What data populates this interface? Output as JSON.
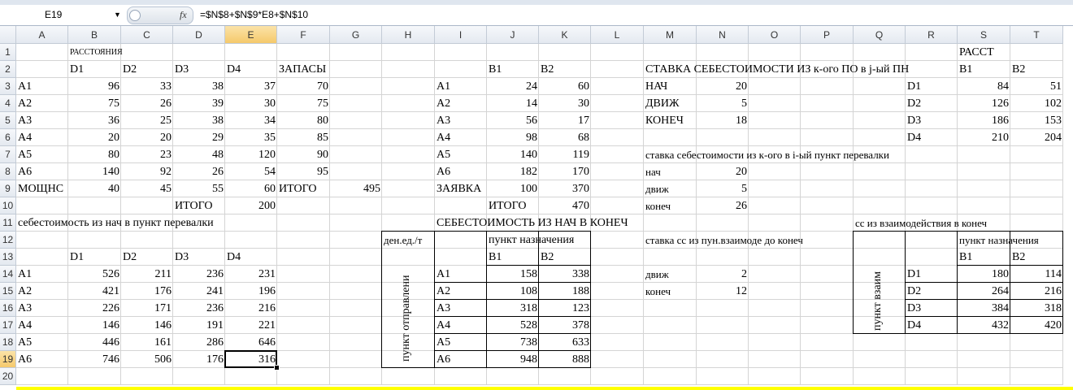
{
  "formula_bar": {
    "name_box": "E19",
    "fx_symbol": "fx",
    "formula": "=$N$8+$N$9*E8+$N$10"
  },
  "columns": [
    "A",
    "B",
    "C",
    "D",
    "E",
    "F",
    "G",
    "H",
    "I",
    "J",
    "K",
    "L",
    "M",
    "N",
    "O",
    "P",
    "Q",
    "R",
    "S",
    "T"
  ],
  "rows": [
    "1",
    "2",
    "3",
    "4",
    "5",
    "6",
    "7",
    "8",
    "9",
    "10",
    "11",
    "12",
    "13",
    "14",
    "15",
    "16",
    "17",
    "18",
    "19",
    "20"
  ],
  "selected": {
    "col": "E",
    "row": 19
  },
  "cells": [
    [
      "B1",
      "РАССТОЯНИЯ",
      "l",
      10
    ],
    [
      "B2",
      "D1"
    ],
    [
      "C2",
      "D2"
    ],
    [
      "D2",
      "D3"
    ],
    [
      "E2",
      "D4"
    ],
    [
      "F2",
      "ЗАПАСЫ"
    ],
    [
      "A3",
      "A1"
    ],
    [
      "B3",
      "96",
      "r"
    ],
    [
      "C3",
      "33",
      "r"
    ],
    [
      "D3",
      "38",
      "r"
    ],
    [
      "E3",
      "37",
      "r"
    ],
    [
      "F3",
      "70",
      "r"
    ],
    [
      "A4",
      "A2"
    ],
    [
      "B4",
      "75",
      "r"
    ],
    [
      "C4",
      "26",
      "r"
    ],
    [
      "D4",
      "39",
      "r"
    ],
    [
      "E4",
      "30",
      "r"
    ],
    [
      "F4",
      "75",
      "r"
    ],
    [
      "A5",
      "A3"
    ],
    [
      "B5",
      "36",
      "r"
    ],
    [
      "C5",
      "25",
      "r"
    ],
    [
      "D5",
      "38",
      "r"
    ],
    [
      "E5",
      "34",
      "r"
    ],
    [
      "F5",
      "80",
      "r"
    ],
    [
      "A6",
      "A4"
    ],
    [
      "B6",
      "20",
      "r"
    ],
    [
      "C6",
      "20",
      "r"
    ],
    [
      "D6",
      "29",
      "r"
    ],
    [
      "E6",
      "35",
      "r"
    ],
    [
      "F6",
      "85",
      "r"
    ],
    [
      "A7",
      "A5"
    ],
    [
      "B7",
      "80",
      "r"
    ],
    [
      "C7",
      "23",
      "r"
    ],
    [
      "D7",
      "48",
      "r"
    ],
    [
      "E7",
      "120",
      "r"
    ],
    [
      "F7",
      "90",
      "r"
    ],
    [
      "A8",
      "A6"
    ],
    [
      "B8",
      "140",
      "r"
    ],
    [
      "C8",
      "92",
      "r"
    ],
    [
      "D8",
      "26",
      "r"
    ],
    [
      "E8",
      "54",
      "r"
    ],
    [
      "F8",
      "95",
      "r"
    ],
    [
      "A9",
      "МОЩНС"
    ],
    [
      "B9",
      "40",
      "r"
    ],
    [
      "C9",
      "45",
      "r"
    ],
    [
      "D9",
      "55",
      "r"
    ],
    [
      "E9",
      "60",
      "r"
    ],
    [
      "F9",
      "ИТОГО"
    ],
    [
      "G9",
      "495",
      "r"
    ],
    [
      "D10",
      "ИТОГО"
    ],
    [
      "E10",
      "200",
      "r"
    ],
    [
      "A11",
      "себестоимость из нач в пункт перевалки"
    ],
    [
      "B13",
      "D1"
    ],
    [
      "C13",
      "D2"
    ],
    [
      "D13",
      "D3"
    ],
    [
      "E13",
      "D4"
    ],
    [
      "A14",
      "A1"
    ],
    [
      "B14",
      "526",
      "r"
    ],
    [
      "C14",
      "211",
      "r"
    ],
    [
      "D14",
      "236",
      "r"
    ],
    [
      "E14",
      "231",
      "r"
    ],
    [
      "A15",
      "A2"
    ],
    [
      "B15",
      "421",
      "r"
    ],
    [
      "C15",
      "176",
      "r"
    ],
    [
      "D15",
      "241",
      "r"
    ],
    [
      "E15",
      "196",
      "r"
    ],
    [
      "A16",
      "A3"
    ],
    [
      "B16",
      "226",
      "r"
    ],
    [
      "C16",
      "171",
      "r"
    ],
    [
      "D16",
      "236",
      "r"
    ],
    [
      "E16",
      "216",
      "r"
    ],
    [
      "A17",
      "A4"
    ],
    [
      "B17",
      "146",
      "r"
    ],
    [
      "C17",
      "146",
      "r"
    ],
    [
      "D17",
      "191",
      "r"
    ],
    [
      "E17",
      "221",
      "r"
    ],
    [
      "A18",
      "A5"
    ],
    [
      "B18",
      "446",
      "r"
    ],
    [
      "C18",
      "161",
      "r"
    ],
    [
      "D18",
      "286",
      "r"
    ],
    [
      "E18",
      "646",
      "r"
    ],
    [
      "A19",
      "A6"
    ],
    [
      "B19",
      "746",
      "r"
    ],
    [
      "C19",
      "506",
      "r"
    ],
    [
      "D19",
      "176",
      "r"
    ],
    [
      "E19",
      "316",
      "r"
    ],
    [
      "J2",
      "B1"
    ],
    [
      "K2",
      "B2"
    ],
    [
      "I3",
      "A1"
    ],
    [
      "J3",
      "24",
      "r"
    ],
    [
      "K3",
      "60",
      "r"
    ],
    [
      "I4",
      "A2"
    ],
    [
      "J4",
      "14",
      "r"
    ],
    [
      "K4",
      "30",
      "r"
    ],
    [
      "I5",
      "A3"
    ],
    [
      "J5",
      "56",
      "r"
    ],
    [
      "K5",
      "17",
      "r"
    ],
    [
      "I6",
      "A4"
    ],
    [
      "J6",
      "98",
      "r"
    ],
    [
      "K6",
      "68",
      "r"
    ],
    [
      "I7",
      "A5"
    ],
    [
      "J7",
      "140",
      "r"
    ],
    [
      "K7",
      "119",
      "r"
    ],
    [
      "I8",
      "A6"
    ],
    [
      "J8",
      "182",
      "r"
    ],
    [
      "K8",
      "170",
      "r"
    ],
    [
      "I9",
      "ЗАЯВКА"
    ],
    [
      "J9",
      "100",
      "r"
    ],
    [
      "K9",
      "370",
      "r"
    ],
    [
      "J10",
      "ИТОГО"
    ],
    [
      "K10",
      "470",
      "r"
    ],
    [
      "I11",
      "СЕБЕСТОИМОСТЬ ИЗ НАЧ В КОНЕЧ"
    ],
    [
      "H12",
      "ден.ед./т",
      "l",
      13
    ],
    [
      "J12",
      "пункт назначения"
    ],
    [
      "J13",
      "B1"
    ],
    [
      "K13",
      "B2"
    ],
    [
      "I14",
      "A1"
    ],
    [
      "J14",
      "158",
      "r"
    ],
    [
      "K14",
      "338",
      "r"
    ],
    [
      "I15",
      "A2"
    ],
    [
      "J15",
      "108",
      "r"
    ],
    [
      "K15",
      "188",
      "r"
    ],
    [
      "I16",
      "A3"
    ],
    [
      "J16",
      "318",
      "r"
    ],
    [
      "K16",
      "123",
      "r"
    ],
    [
      "I17",
      "A4"
    ],
    [
      "J17",
      "528",
      "r"
    ],
    [
      "K17",
      "378",
      "r"
    ],
    [
      "I18",
      "A5"
    ],
    [
      "J18",
      "738",
      "r"
    ],
    [
      "K18",
      "633",
      "r"
    ],
    [
      "I19",
      "A6"
    ],
    [
      "J19",
      "948",
      "r"
    ],
    [
      "K19",
      "888",
      "r"
    ],
    [
      "M2",
      "СТАВКА СЕБЕСТОИМОСТИ ИЗ к-ого ПО в j-ый ПН"
    ],
    [
      "M3",
      "НАЧ"
    ],
    [
      "N3",
      "20",
      "r"
    ],
    [
      "M4",
      "ДВИЖ"
    ],
    [
      "N4",
      "5",
      "r"
    ],
    [
      "M5",
      "КОНЕЧ"
    ],
    [
      "N5",
      "18",
      "r"
    ],
    [
      "M7",
      "ставка себестоимости из к-ого в i-ый пункт перевалки",
      "l",
      13
    ],
    [
      "M8",
      "нач",
      "l",
      13
    ],
    [
      "N8",
      "20",
      "r"
    ],
    [
      "M9",
      "движ",
      "l",
      13
    ],
    [
      "N9",
      "5",
      "r"
    ],
    [
      "M10",
      "конеч",
      "l",
      13
    ],
    [
      "N10",
      "26",
      "r"
    ],
    [
      "M12",
      "ставка сс из пун.взаимоде до конеч",
      "l",
      13
    ],
    [
      "M14",
      "движ",
      "l",
      13
    ],
    [
      "N14",
      "2",
      "r"
    ],
    [
      "M15",
      "конеч",
      "l",
      13
    ],
    [
      "N15",
      "12",
      "r"
    ],
    [
      "Q11",
      "сс из взаимодействия в конеч",
      "l",
      13
    ],
    [
      "S1",
      "РАССТ"
    ],
    [
      "S2",
      "B1"
    ],
    [
      "T2",
      "B2"
    ],
    [
      "R3",
      "D1"
    ],
    [
      "S3",
      "84",
      "r"
    ],
    [
      "T3",
      "51",
      "r"
    ],
    [
      "R4",
      "D2"
    ],
    [
      "S4",
      "126",
      "r"
    ],
    [
      "T4",
      "102",
      "r"
    ],
    [
      "R5",
      "D3"
    ],
    [
      "S5",
      "186",
      "r"
    ],
    [
      "T5",
      "153",
      "r"
    ],
    [
      "R6",
      "D4"
    ],
    [
      "S6",
      "210",
      "r"
    ],
    [
      "T6",
      "204",
      "r"
    ],
    [
      "S12",
      "пункт назначения",
      "l",
      13
    ],
    [
      "S13",
      "B1"
    ],
    [
      "T13",
      "B2"
    ],
    [
      "R14",
      "D1"
    ],
    [
      "S14",
      "180",
      "r"
    ],
    [
      "T14",
      "114",
      "r"
    ],
    [
      "R15",
      "D2"
    ],
    [
      "S15",
      "264",
      "r"
    ],
    [
      "T15",
      "216",
      "r"
    ],
    [
      "R16",
      "D3"
    ],
    [
      "S16",
      "384",
      "r"
    ],
    [
      "T16",
      "318",
      "r"
    ],
    [
      "R17",
      "D4"
    ],
    [
      "S17",
      "432",
      "r"
    ],
    [
      "T17",
      "420",
      "r"
    ]
  ],
  "vertical_labels": {
    "table1": "пункт отправлени",
    "table2": "пункт взаим"
  }
}
